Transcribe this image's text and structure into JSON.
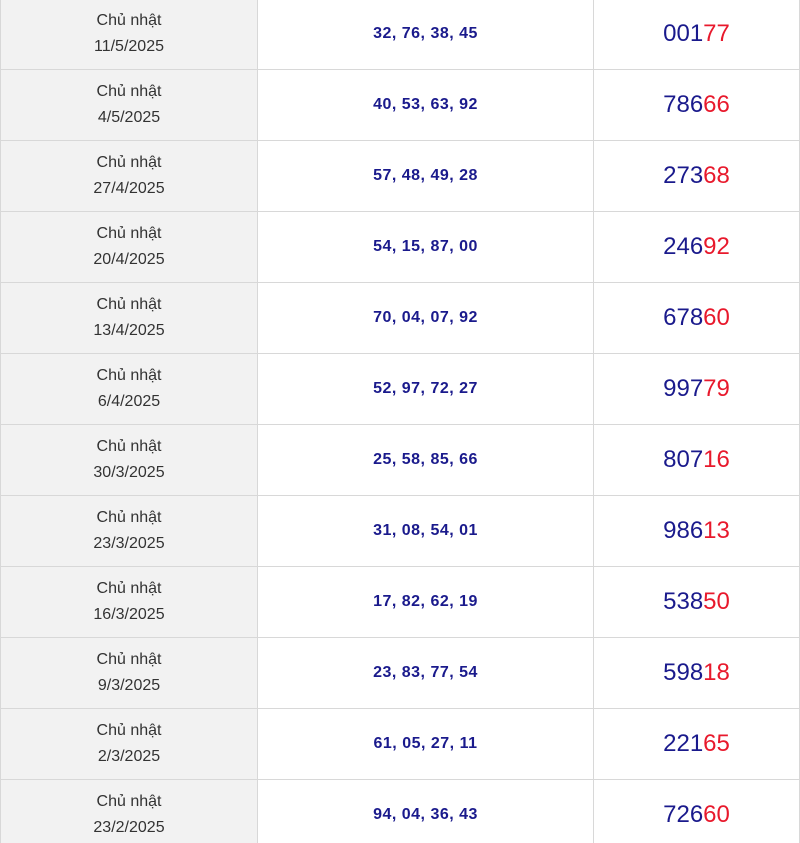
{
  "rows": [
    {
      "day": "Chủ nhật",
      "date": "11/5/2025",
      "numbers": "32, 76, 38, 45",
      "special_head": "001",
      "special_tail": "77"
    },
    {
      "day": "Chủ nhật",
      "date": "4/5/2025",
      "numbers": "40, 53, 63, 92",
      "special_head": "786",
      "special_tail": "66"
    },
    {
      "day": "Chủ nhật",
      "date": "27/4/2025",
      "numbers": "57, 48, 49, 28",
      "special_head": "273",
      "special_tail": "68"
    },
    {
      "day": "Chủ nhật",
      "date": "20/4/2025",
      "numbers": "54, 15, 87, 00",
      "special_head": "246",
      "special_tail": "92"
    },
    {
      "day": "Chủ nhật",
      "date": "13/4/2025",
      "numbers": "70, 04, 07, 92",
      "special_head": "678",
      "special_tail": "60"
    },
    {
      "day": "Chủ nhật",
      "date": "6/4/2025",
      "numbers": "52, 97, 72, 27",
      "special_head": "997",
      "special_tail": "79"
    },
    {
      "day": "Chủ nhật",
      "date": "30/3/2025",
      "numbers": "25, 58, 85, 66",
      "special_head": "807",
      "special_tail": "16"
    },
    {
      "day": "Chủ nhật",
      "date": "23/3/2025",
      "numbers": "31, 08, 54, 01",
      "special_head": "986",
      "special_tail": "13"
    },
    {
      "day": "Chủ nhật",
      "date": "16/3/2025",
      "numbers": "17, 82, 62, 19",
      "special_head": "538",
      "special_tail": "50"
    },
    {
      "day": "Chủ nhật",
      "date": "9/3/2025",
      "numbers": "23, 83, 77, 54",
      "special_head": "598",
      "special_tail": "18"
    },
    {
      "day": "Chủ nhật",
      "date": "2/3/2025",
      "numbers": "61, 05, 27, 11",
      "special_head": "221",
      "special_tail": "65"
    },
    {
      "day": "Chủ nhật",
      "date": "23/2/2025",
      "numbers": "94, 04, 36, 43",
      "special_head": "726",
      "special_tail": "60"
    }
  ],
  "colors": {
    "number_blue": "#1a1a8c",
    "tail_red": "#e8192c",
    "date_bg": "#f2f2f2",
    "border": "#d8d8d8"
  }
}
